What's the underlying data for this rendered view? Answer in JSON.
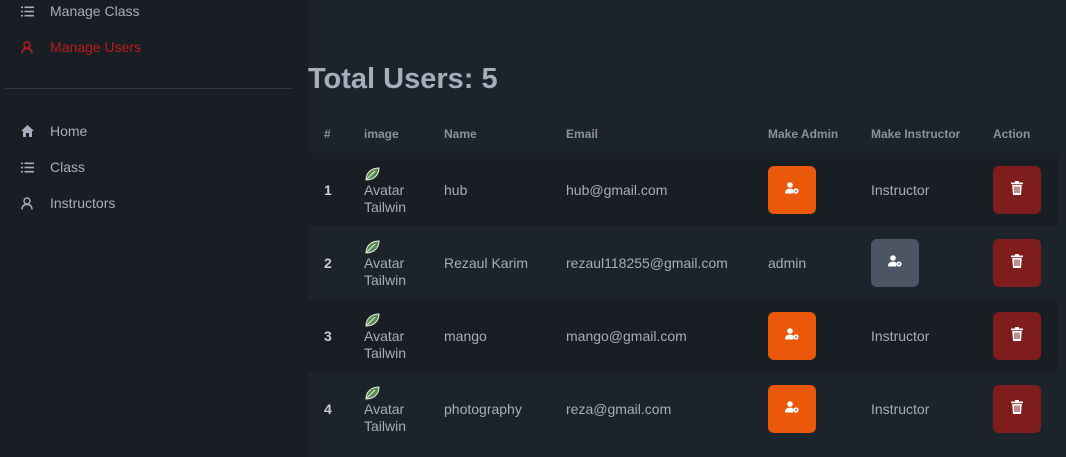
{
  "sidebar": {
    "items_top": [
      {
        "label": "Manage Class",
        "icon": "list-icon"
      },
      {
        "label": "Manage Users",
        "icon": "user-icon",
        "active": true
      }
    ],
    "items_bottom": [
      {
        "label": "Home",
        "icon": "home-icon"
      },
      {
        "label": "Class",
        "icon": "list-icon"
      },
      {
        "label": "Instructors",
        "icon": "user-icon"
      }
    ]
  },
  "main": {
    "title": "Total Users: 5",
    "table": {
      "headers": [
        "#",
        "image",
        "Name",
        "Email",
        "Make Admin",
        "Make Instructor",
        "Action"
      ],
      "rows": [
        {
          "num": "1",
          "image_alt": "Avatar Tailwind",
          "name": "hub",
          "email": "hub@gmail.com",
          "admin": {
            "type": "button",
            "text": ""
          },
          "instructor": {
            "type": "text",
            "text": "Instructor"
          }
        },
        {
          "num": "2",
          "image_alt": "Avatar Tailwind",
          "name": "Rezaul Karim",
          "email": "rezaul118255@gmail.com",
          "admin": {
            "type": "text",
            "text": "admin"
          },
          "instructor": {
            "type": "button",
            "text": ""
          }
        },
        {
          "num": "3",
          "image_alt": "Avatar Tailwind",
          "name": "mango",
          "email": "mango@gmail.com",
          "admin": {
            "type": "button",
            "text": ""
          },
          "instructor": {
            "type": "text",
            "text": "Instructor"
          }
        },
        {
          "num": "4",
          "image_alt": "Avatar Tailwind",
          "name": "photography",
          "email": "reza@gmail.com",
          "admin": {
            "type": "button",
            "text": ""
          },
          "instructor": {
            "type": "text",
            "text": "Instructor"
          }
        }
      ]
    }
  },
  "colors": {
    "accent_active": "#b91c1c",
    "make_admin_button": "#ea580c",
    "make_instructor_button": "#4b5563",
    "delete_button": "#7f1d1d"
  }
}
